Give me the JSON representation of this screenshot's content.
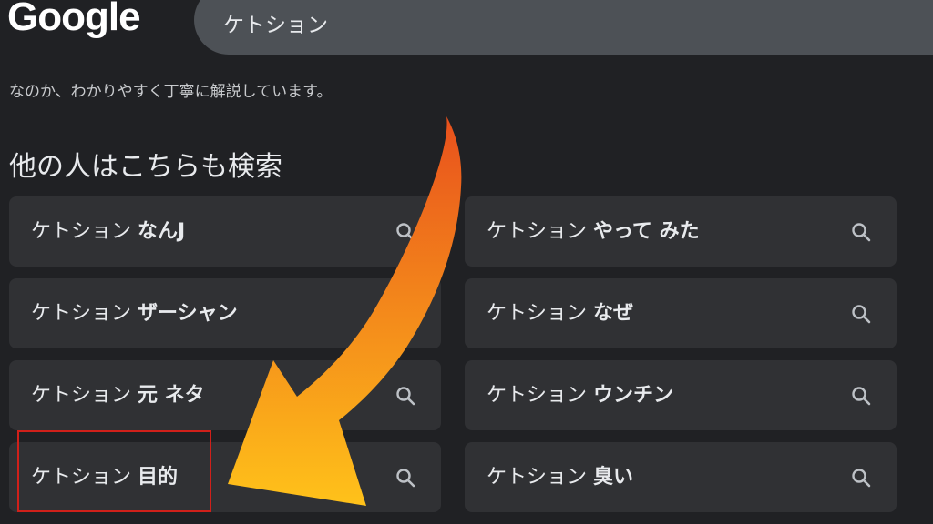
{
  "header": {
    "logo_text": "Google",
    "search_value": "ケトション"
  },
  "snippet_text": "なのか、わかりやすく丁寧に解説しています。",
  "related": {
    "title": "他の人はこちらも検索",
    "items": [
      {
        "prefix": "ケトション",
        "bold": "なんJ"
      },
      {
        "prefix": "ケトション",
        "bold": "やって みた"
      },
      {
        "prefix": "ケトション",
        "bold": "ザーシャン"
      },
      {
        "prefix": "ケトション",
        "bold": "なぜ"
      },
      {
        "prefix": "ケトション",
        "bold": "元 ネタ"
      },
      {
        "prefix": "ケトション",
        "bold": "ウンチン"
      },
      {
        "prefix": "ケトション",
        "bold": "目的"
      },
      {
        "prefix": "ケトション",
        "bold": "臭い"
      }
    ]
  },
  "colors": {
    "background": "#202124",
    "chip": "#303134",
    "highlight_border": "#d0201a",
    "arrow_start": "#e8501c",
    "arrow_end": "#ffc21a"
  },
  "icons": {
    "chip_icon": "search-icon"
  }
}
